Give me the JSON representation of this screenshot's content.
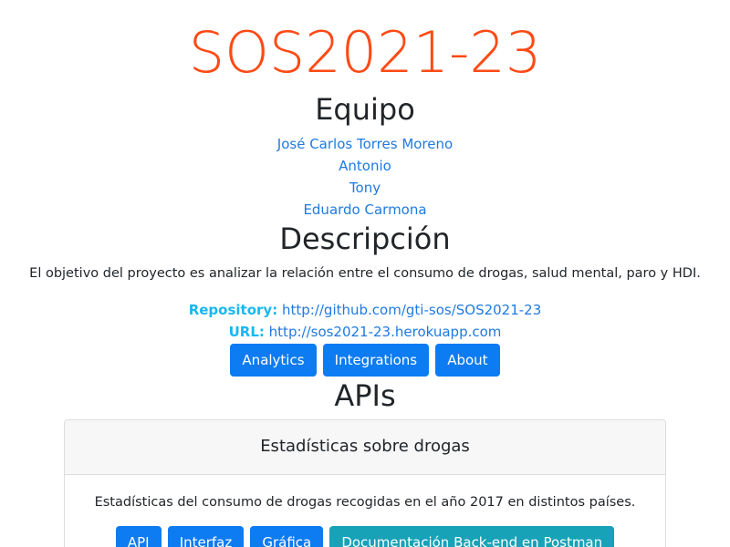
{
  "header": {
    "title": "SOS2021-23"
  },
  "team": {
    "heading": "Equipo",
    "members": [
      "José Carlos Torres Moreno",
      "Antonio",
      "Tony",
      "Eduardo Carmona"
    ]
  },
  "description": {
    "heading": "Descripción",
    "text": "El objetivo del proyecto es analizar la relación entre el consumo de drogas, salud mental, paro y HDI."
  },
  "links": {
    "repository_label": "Repository:",
    "repository_url": "http://github.com/gti-sos/SOS2021-23",
    "url_label": "URL:",
    "url_value": "http://sos2021-23.herokuapp.com"
  },
  "nav": {
    "analytics": "Analytics",
    "integrations": "Integrations",
    "about": "About"
  },
  "apis": {
    "heading": "APIs",
    "cards": [
      {
        "title": "Estadísticas sobre drogas",
        "text": "Estadísticas del consumo de drogas recogidas en el año 2017 en distintos países.",
        "buttons": {
          "api": "API",
          "interfaz": "Interfaz",
          "grafica": "Gráfica",
          "docs": "Documentación Back-end en Postman"
        }
      }
    ]
  },
  "colors": {
    "title": "#ff4a14",
    "link": "#1f7ae0",
    "info_label": "#17b8f0",
    "primary_button": "#0d7bf2",
    "teal_button": "#17a2b8"
  }
}
